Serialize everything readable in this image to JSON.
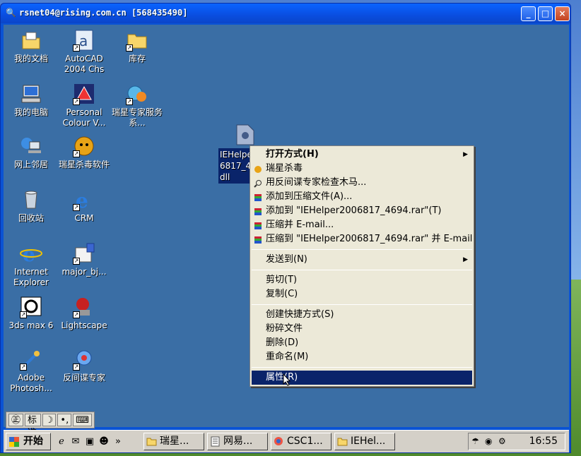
{
  "window": {
    "title": "rsnet04@rising.com.cn [568435490]",
    "buttons": [
      "_",
      "□",
      "×"
    ]
  },
  "desktop_icons": [
    {
      "label": "我的文档",
      "icon": "my-documents-icon"
    },
    {
      "label": "AutoCAD 2004 Chs",
      "icon": "autocad-icon"
    },
    {
      "label": "库存",
      "icon": "folder-icon"
    },
    {
      "label": "我的电脑",
      "icon": "my-computer-icon"
    },
    {
      "label": "Personal Colour V...",
      "icon": "personal-colour-icon"
    },
    {
      "label": "瑞星专家服务系...",
      "icon": "rising-expert-icon"
    },
    {
      "label": "网上邻居",
      "icon": "network-places-icon"
    },
    {
      "label": "瑞星杀毒软件",
      "icon": "rising-antivirus-icon"
    },
    {
      "label": "回收站",
      "icon": "recycle-bin-icon"
    },
    {
      "label": "CRM",
      "icon": "ie-icon"
    },
    {
      "label": "Internet Explorer",
      "icon": "internet-explorer-icon"
    },
    {
      "label": "major_bj...",
      "icon": "major-bj-icon"
    },
    {
      "label": "3ds max 6",
      "icon": "3ds-max-icon"
    },
    {
      "label": "Lightscape",
      "icon": "lightscape-icon"
    },
    {
      "label": "Adobe Photosh...",
      "icon": "photoshop-icon"
    },
    {
      "label": "反间谍专家",
      "icon": "anti-spy-icon"
    }
  ],
  "selected_file": {
    "label": "IEHelper2006817_4694.dll",
    "label_visible": "IEHelpe 6817_4 dll"
  },
  "context_menu": {
    "items": [
      {
        "label": "打开方式(H)",
        "bold": true,
        "submenu": true
      },
      {
        "label": "瑞星杀毒",
        "icon": "rising-icon"
      },
      {
        "label": "用反间谍专家检查木马...",
        "icon": "magnifier-icon"
      },
      {
        "label": "添加到压缩文件(A)...",
        "icon": "rar-icon"
      },
      {
        "label": "添加到 \"IEHelper2006817_4694.rar\"(T)",
        "icon": "rar-icon"
      },
      {
        "label": "压缩并 E-mail...",
        "icon": "rar-icon"
      },
      {
        "label": "压缩到 \"IEHelper2006817_4694.rar\" 并 E-mail",
        "icon": "rar-icon"
      },
      {
        "sep": true
      },
      {
        "label": "发送到(N)",
        "submenu": true
      },
      {
        "sep": true
      },
      {
        "label": "剪切(T)"
      },
      {
        "label": "复制(C)"
      },
      {
        "sep": true
      },
      {
        "label": "创建快捷方式(S)"
      },
      {
        "label": "粉碎文件"
      },
      {
        "label": "删除(D)"
      },
      {
        "label": "重命名(M)"
      },
      {
        "sep": true
      },
      {
        "label": "属性(R)",
        "highlighted": true
      }
    ]
  },
  "language_bar": {
    "ime": "标准",
    "moon": "☽",
    "punct": "•,"
  },
  "taskbar": {
    "start_label": "开始",
    "tasks": [
      "瑞星...",
      "网易...",
      "CSC1...",
      "IEHel..."
    ],
    "clock": "16:55"
  }
}
